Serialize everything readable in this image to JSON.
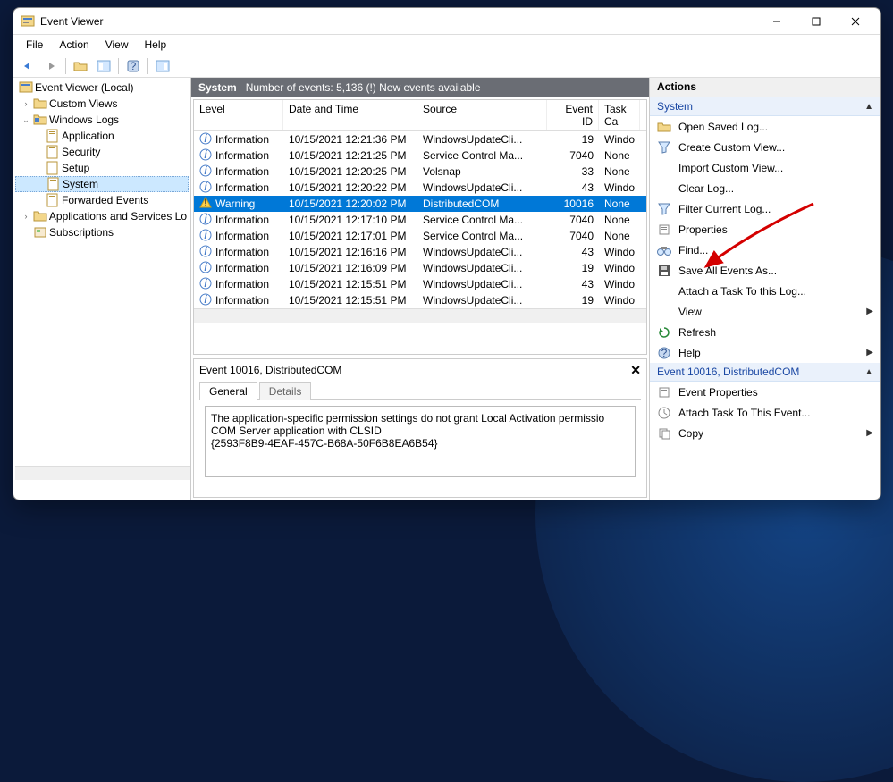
{
  "window": {
    "title": "Event Viewer"
  },
  "menu": {
    "file": "File",
    "action": "Action",
    "view": "View",
    "help": "Help"
  },
  "tree": {
    "root": "Event Viewer (Local)",
    "custom_views": "Custom Views",
    "windows_logs": "Windows Logs",
    "application": "Application",
    "security": "Security",
    "setup": "Setup",
    "system": "System",
    "forwarded": "Forwarded Events",
    "apps_services": "Applications and Services Lo",
    "subscriptions": "Subscriptions"
  },
  "center": {
    "header_title": "System",
    "header_sub": "Number of events: 5,136 (!) New events available",
    "columns": {
      "level": "Level",
      "date": "Date and Time",
      "source": "Source",
      "eventid": "Event ID",
      "task": "Task Ca"
    },
    "rows": [
      {
        "level": "Information",
        "date": "10/15/2021 12:21:36 PM",
        "source": "WindowsUpdateCli...",
        "eventid": "19",
        "task": "Windo"
      },
      {
        "level": "Information",
        "date": "10/15/2021 12:21:25 PM",
        "source": "Service Control Ma...",
        "eventid": "7040",
        "task": "None"
      },
      {
        "level": "Information",
        "date": "10/15/2021 12:20:25 PM",
        "source": "Volsnap",
        "eventid": "33",
        "task": "None"
      },
      {
        "level": "Information",
        "date": "10/15/2021 12:20:22 PM",
        "source": "WindowsUpdateCli...",
        "eventid": "43",
        "task": "Windo"
      },
      {
        "level": "Warning",
        "date": "10/15/2021 12:20:02 PM",
        "source": "DistributedCOM",
        "eventid": "10016",
        "task": "None",
        "selected": true
      },
      {
        "level": "Information",
        "date": "10/15/2021 12:17:10 PM",
        "source": "Service Control Ma...",
        "eventid": "7040",
        "task": "None"
      },
      {
        "level": "Information",
        "date": "10/15/2021 12:17:01 PM",
        "source": "Service Control Ma...",
        "eventid": "7040",
        "task": "None"
      },
      {
        "level": "Information",
        "date": "10/15/2021 12:16:16 PM",
        "source": "WindowsUpdateCli...",
        "eventid": "43",
        "task": "Windo"
      },
      {
        "level": "Information",
        "date": "10/15/2021 12:16:09 PM",
        "source": "WindowsUpdateCli...",
        "eventid": "19",
        "task": "Windo"
      },
      {
        "level": "Information",
        "date": "10/15/2021 12:15:51 PM",
        "source": "WindowsUpdateCli...",
        "eventid": "43",
        "task": "Windo"
      },
      {
        "level": "Information",
        "date": "10/15/2021 12:15:51 PM",
        "source": "WindowsUpdateCli...",
        "eventid": "19",
        "task": "Windo"
      }
    ],
    "detail": {
      "title": "Event 10016, DistributedCOM",
      "tab_general": "General",
      "tab_details": "Details",
      "line1": "The application-specific permission settings do not grant Local Activation permissio",
      "line2": "COM Server application with CLSID",
      "line3": "{2593F8B9-4EAF-457C-B68A-50F6B8EA6B54}"
    }
  },
  "actions": {
    "header": "Actions",
    "section1": "System",
    "open_saved_log": "Open Saved Log...",
    "create_custom_view": "Create Custom View...",
    "import_custom_view": "Import Custom View...",
    "clear_log": "Clear Log...",
    "filter_current_log": "Filter Current Log...",
    "properties": "Properties",
    "find": "Find...",
    "save_all": "Save All Events As...",
    "attach_task": "Attach a Task To this Log...",
    "view": "View",
    "refresh": "Refresh",
    "help": "Help",
    "section2": "Event 10016, DistributedCOM",
    "event_properties": "Event Properties",
    "attach_task_event": "Attach Task To This Event...",
    "copy": "Copy"
  }
}
